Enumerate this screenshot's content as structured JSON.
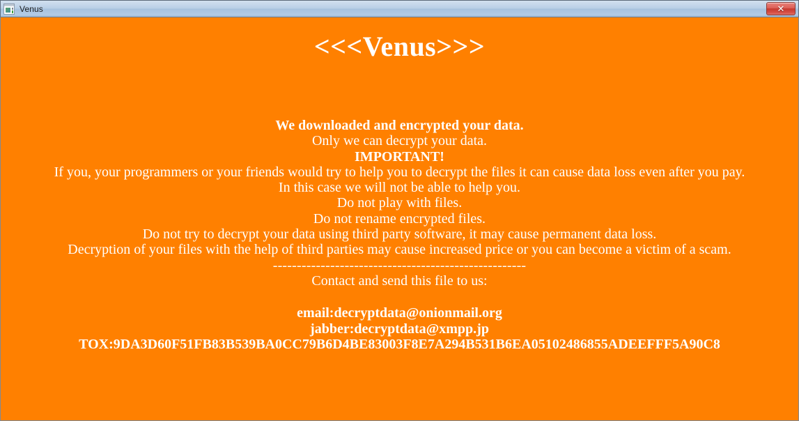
{
  "window": {
    "title": "Venus",
    "icon": "app-window-icon",
    "close_label": "✕",
    "background_color": "#ff8000",
    "text_color": "#ffffff",
    "titlebar_color": "#b9cfe6",
    "close_button_color": "#c6392f"
  },
  "note": {
    "banner": "<<<Venus>>>",
    "lines": [
      {
        "text": "We downloaded and encrypted your data.",
        "bold": true
      },
      {
        "text": "Only we can decrypt your data.",
        "bold": false
      },
      {
        "text": "IMPORTANT!",
        "bold": true
      },
      {
        "text": "If you, your programmers or your friends would try to help you to decrypt the files it can cause data loss even after you pay.",
        "bold": false
      },
      {
        "text": "In this case we will not be able to help you.",
        "bold": false
      },
      {
        "text": "Do not play with files.",
        "bold": false
      },
      {
        "text": "Do not rename encrypted files.",
        "bold": false
      },
      {
        "text": "Do not try to decrypt your data using third party software, it may cause permanent data loss.",
        "bold": false
      },
      {
        "text": "Decryption of your files with the help of third parties may cause increased price or you can become a victim of a scam.",
        "bold": false
      }
    ],
    "separator": "-----------------------------------------------------",
    "contact_prompt": "Contact and send this file to us:",
    "email": "email:decryptdata@onionmail.org",
    "jabber": "jabber:decryptdata@xmpp.jp",
    "tox": "TOX:9DA3D60F51FB83B539BA0CC79B6D4BE83003F8E7A294B531B6EA05102486855ADEEFFF5A90C8"
  }
}
